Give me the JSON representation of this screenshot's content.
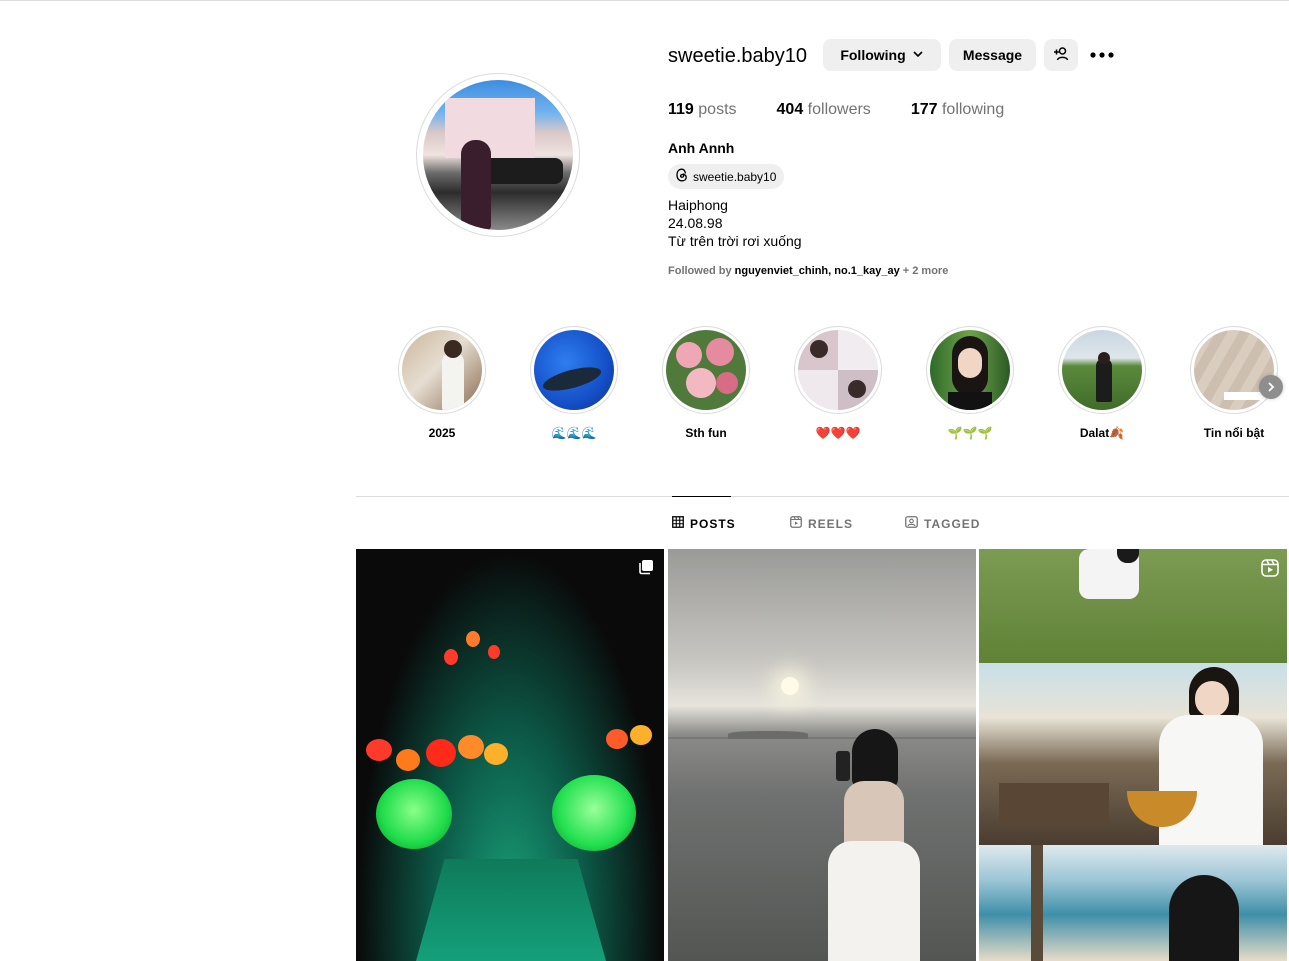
{
  "profile": {
    "username": "sweetie.baby10",
    "following_button": "Following",
    "message_button": "Message",
    "stats": {
      "posts_count": "119",
      "posts_label": "posts",
      "followers_count": "404",
      "followers_label": "followers",
      "following_count": "177",
      "following_label": "following"
    },
    "full_name": "Anh Annh",
    "threads_handle": "sweetie.baby10",
    "bio": [
      "Haiphong",
      "24.08.98",
      "Từ trên trời rơi xuống"
    ],
    "followed_by": {
      "prefix": "Followed by",
      "names": [
        "nguyenviet_chinh",
        "no.1_kay_ay"
      ],
      "separator": ",",
      "more": "+ 2 more"
    }
  },
  "highlights": [
    {
      "label": "2025"
    },
    {
      "label": "🌊🌊🌊"
    },
    {
      "label": "Sth fun"
    },
    {
      "label": "❤️❤️❤️"
    },
    {
      "label": "🌱🌱🌱"
    },
    {
      "label": "Dalat🍂"
    },
    {
      "label": "Tin nổi bật"
    }
  ],
  "tabs": [
    {
      "label": "POSTS",
      "icon": "grid-icon",
      "active": true
    },
    {
      "label": "REELS",
      "icon": "reels-icon",
      "active": false
    },
    {
      "label": "TAGGED",
      "icon": "tagged-icon",
      "active": false
    }
  ],
  "colors": {
    "button_bg": "#efefef",
    "secondary_text": "#737373",
    "divider": "#dbdbdb"
  }
}
